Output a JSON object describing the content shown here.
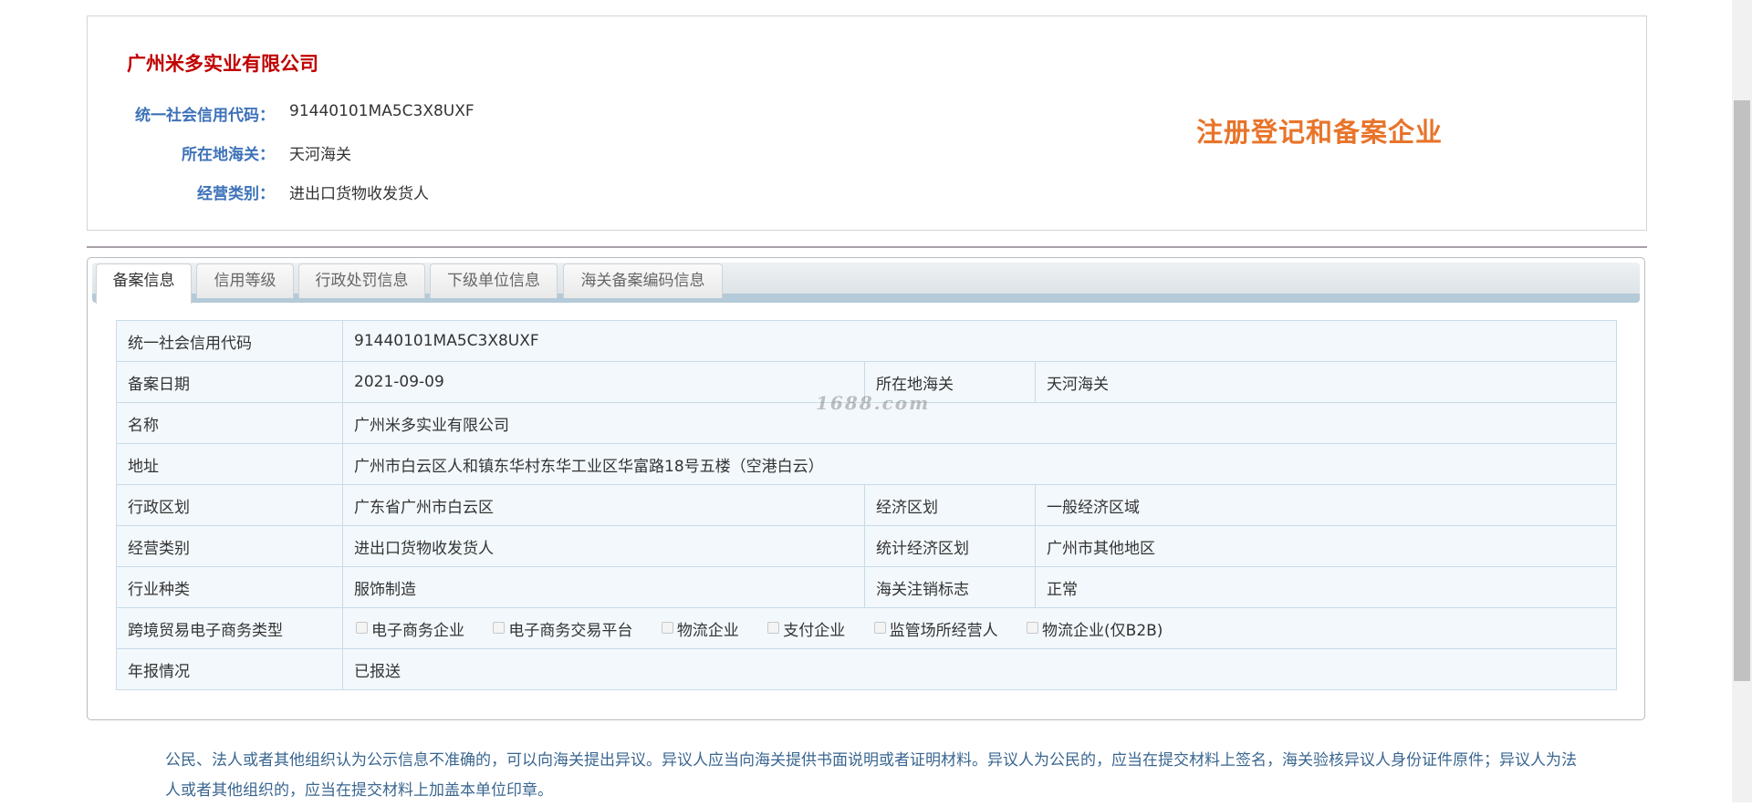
{
  "company": {
    "name": "广州米多实业有限公司",
    "fields": [
      {
        "label": "统一社会信用代码：",
        "value": "91440101MA5C3X8UXF"
      },
      {
        "label": "所在地海关：",
        "value": "天河海关"
      },
      {
        "label": "经营类别：",
        "value": "进出口货物收发货人"
      }
    ],
    "stamp": "注册登记和备案企业",
    "stamp_color": "#e8742a",
    "title_color": "#c00000"
  },
  "tabs": [
    {
      "label": "备案信息",
      "active": true
    },
    {
      "label": "信用等级"
    },
    {
      "label": "行政处罚信息"
    },
    {
      "label": "下级单位信息"
    },
    {
      "label": "海关备案编码信息"
    }
  ],
  "table": {
    "credit_code": {
      "label": "统一社会信用代码",
      "value": "91440101MA5C3X8UXF"
    },
    "record_date": {
      "label": "备案日期",
      "value": "2021-09-09"
    },
    "customs": {
      "label": "所在地海关",
      "value": "天河海关"
    },
    "name": {
      "label": "名称",
      "value": "广州米多实业有限公司"
    },
    "address": {
      "label": "地址",
      "value": "广州市白云区人和镇东华村东华工业区华富路18号五楼（空港白云）"
    },
    "admin_region": {
      "label": "行政区划",
      "value": "广东省广州市白云区"
    },
    "econ_region": {
      "label": "经济区划",
      "value": "一般经济区域"
    },
    "business_type": {
      "label": "经营类别",
      "value": "进出口货物收发货人"
    },
    "stat_region": {
      "label": "统计经济区划",
      "value": "广州市其他地区"
    },
    "industry": {
      "label": "行业种类",
      "value": "服饰制造"
    },
    "cancel_flag": {
      "label": "海关注销标志",
      "value": "正常"
    },
    "ecommerce": {
      "label": "跨境贸易电子商务类型",
      "options": [
        {
          "label": "电子商务企业",
          "checked": false
        },
        {
          "label": "电子商务交易平台",
          "checked": false
        },
        {
          "label": "物流企业",
          "checked": false
        },
        {
          "label": "支付企业",
          "checked": false
        },
        {
          "label": "监管场所经营人",
          "checked": false
        },
        {
          "label": "物流企业(仅B2B)",
          "checked": false
        }
      ]
    },
    "annual_report": {
      "label": "年报情况",
      "value": "已报送"
    }
  },
  "watermark": "1688.com",
  "notice": "公民、法人或者其他组织认为公示信息不准确的，可以向海关提出异议。异议人应当向海关提供书面说明或者证明材料。异议人为公民的，应当在提交材料上签名，海关验核异议人身份证件原件；异议人为法人或者其他组织的，应当在提交材料上加盖本单位印章。"
}
